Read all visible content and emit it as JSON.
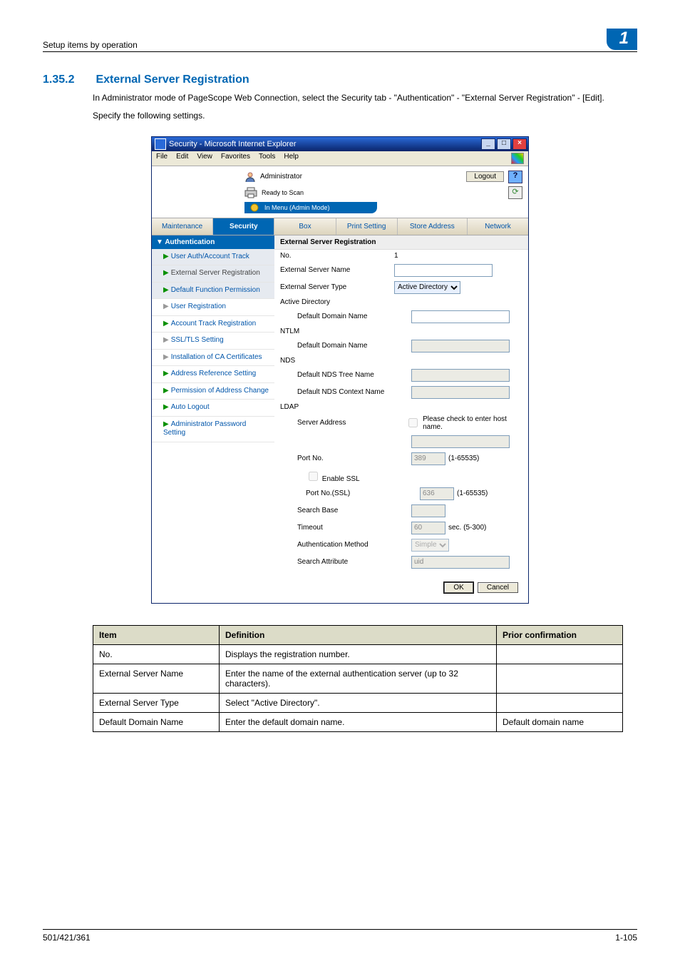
{
  "doc": {
    "header_left": "Setup items by operation",
    "header_right": "1",
    "section_number": "1.35.2",
    "section_title": "External Server Registration",
    "intro1": "In Administrator mode of PageScope Web Connection, select the Security tab - \"Authentication\" - \"External Server Registration\" - [Edit].",
    "intro2": "Specify the following settings.",
    "footer_left": "501/421/361",
    "footer_right": "1-105"
  },
  "window": {
    "title": "Security - Microsoft Internet Explorer",
    "minimize": "_",
    "maximize": "□",
    "close": "×",
    "menubar": [
      "File",
      "Edit",
      "View",
      "Favorites",
      "Tools",
      "Help"
    ]
  },
  "top": {
    "user_label": "Administrator",
    "logout": "Logout",
    "help": "?",
    "status": "Ready to Scan",
    "mode": "In Menu (Admin Mode)",
    "refresh": "⟳"
  },
  "tabs": [
    "Maintenance",
    "Security",
    "Box",
    "Print Setting",
    "Store Address",
    "Network"
  ],
  "activeTab": 1,
  "sidebar": {
    "header": "Authentication",
    "items": [
      {
        "label": "User Auth/Account Track",
        "type": "group"
      },
      {
        "label": "External Server Registration",
        "type": "active"
      },
      {
        "label": "Default Function Permission",
        "type": "group"
      },
      {
        "label": "User Registration",
        "type": "top"
      },
      {
        "label": "Account Track Registration",
        "type": "top"
      },
      {
        "label": "SSL/TLS Setting",
        "type": "top"
      },
      {
        "label": "Installation of CA Certificates",
        "type": "top"
      },
      {
        "label": "Address Reference Setting",
        "type": "top"
      },
      {
        "label": "Permission of Address Change",
        "type": "top"
      },
      {
        "label": "Auto Logout",
        "type": "top"
      },
      {
        "label": "Administrator Password Setting",
        "type": "top"
      }
    ]
  },
  "form": {
    "title": "External Server Registration",
    "no_label": "No.",
    "no_value": "1",
    "ext_name_label": "External Server Name",
    "ext_name_value": "",
    "ext_type_label": "External Server Type",
    "ext_type_value": "Active Directory",
    "ad_group": "Active Directory",
    "ad_default_domain": "Default Domain Name",
    "ad_default_value": "",
    "ntlm_group": "NTLM",
    "ntlm_default_domain": "Default Domain Name",
    "ntlm_default_value": "",
    "nds_group": "NDS",
    "nds_tree": "Default NDS Tree Name",
    "nds_tree_value": "",
    "nds_context": "Default NDS Context Name",
    "nds_context_value": "",
    "ldap_group": "LDAP",
    "server_address": "Server Address",
    "server_address_value": "",
    "host_check": "Please check to enter host name.",
    "port_no": "Port No.",
    "port_no_value": "389",
    "port_range": "(1-65535)",
    "enable_ssl": "Enable SSL",
    "port_ssl": "Port No.(SSL)",
    "port_ssl_value": "636",
    "search_base": "Search Base",
    "search_base_value": "",
    "timeout": "Timeout",
    "timeout_value": "60",
    "timeout_unit": "sec. (5-300)",
    "auth_method": "Authentication Method",
    "auth_method_value": "Simple",
    "search_attr": "Search Attribute",
    "search_attr_value": "uid",
    "ok": "OK",
    "cancel": "Cancel"
  },
  "spec": {
    "h_item": "Item",
    "h_def": "Definition",
    "h_prior": "Prior confirmation",
    "rows": [
      {
        "item": "No.",
        "def": "Displays the registration number.",
        "prior": ""
      },
      {
        "item": "External Server Name",
        "def": "Enter the name of the external authentication server (up to 32 characters).",
        "prior": ""
      },
      {
        "item": "External Server Type",
        "def": "Select \"Active Directory\".",
        "prior": ""
      },
      {
        "item": "Default Domain Name",
        "def": "Enter the default domain name.",
        "prior": "Default domain name"
      }
    ]
  }
}
